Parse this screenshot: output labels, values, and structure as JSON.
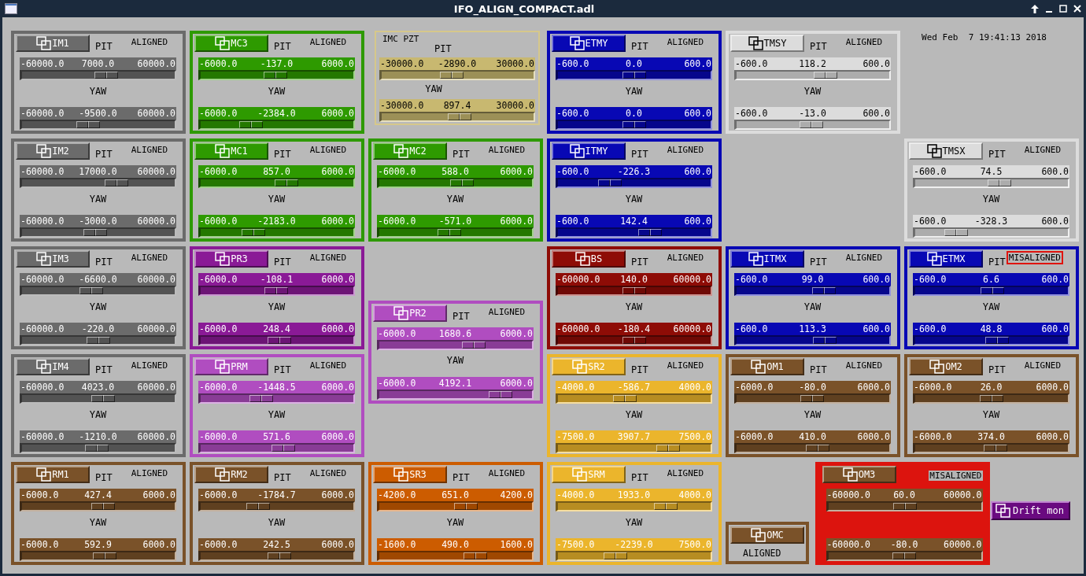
{
  "window": {
    "title": "IFO_ALIGN_COMPACT.adl"
  },
  "timestamp": "Wed Feb  7 19:41:13 2018",
  "cards": [
    {
      "kind": "suspension",
      "name": "IM1",
      "color": "#6b6b6b",
      "status": "ALIGNED",
      "misaligned": false,
      "sliders": [
        {
          "label": "PIT",
          "min": "-60000.0",
          "value": "7000.0",
          "max": "60000.0",
          "level": 0.558
        },
        {
          "label": "YAW",
          "min": "-60000.0",
          "value": "-9500.0",
          "max": "60000.0",
          "level": 0.421
        }
      ]
    },
    {
      "kind": "suspension",
      "name": "MC3",
      "color": "#2e9a00",
      "status": "ALIGNED",
      "misaligned": false,
      "sliders": [
        {
          "label": "PIT",
          "min": "-6000.0",
          "value": "-137.0",
          "max": "6000.0",
          "level": 0.489
        },
        {
          "label": "YAW",
          "min": "-6000.0",
          "value": "-2384.0",
          "max": "6000.0",
          "level": 0.301
        }
      ]
    },
    {
      "kind": "pzt",
      "name": "IMC PZT",
      "color": "#c8b870",
      "sliders": [
        {
          "label": "PIT",
          "min": "-30000.0",
          "value": "-2890.0",
          "max": "30000.0",
          "level": 0.452
        },
        {
          "label": "YAW",
          "min": "-30000.0",
          "value": "897.4",
          "max": "30000.0",
          "level": 0.515
        }
      ]
    },
    {
      "kind": "suspension",
      "name": "ETMY",
      "color": "#0808b4",
      "status": "ALIGNED",
      "misaligned": false,
      "sliders": [
        {
          "label": "PIT",
          "min": "-600.0",
          "value": "0.0",
          "max": "600.0",
          "level": 0.5
        },
        {
          "label": "YAW",
          "min": "-600.0",
          "value": "0.0",
          "max": "600.0",
          "level": 0.5
        }
      ]
    },
    {
      "kind": "suspension",
      "name": "TMSY",
      "color": "#dcdcdc",
      "status": "ALIGNED",
      "misaligned": false,
      "sliders": [
        {
          "label": "PIT",
          "min": "-600.0",
          "value": "118.2",
          "max": "600.0",
          "level": 0.599
        },
        {
          "label": "YAW",
          "min": "-600.0",
          "value": "-13.0",
          "max": "600.0",
          "level": 0.489
        }
      ]
    },
    {
      "kind": "suspension",
      "name": "IM2",
      "color": "#6b6b6b",
      "status": "ALIGNED",
      "misaligned": false,
      "sliders": [
        {
          "label": "PIT",
          "min": "-60000.0",
          "value": "17000.0",
          "max": "60000.0",
          "level": 0.642
        },
        {
          "label": "YAW",
          "min": "-60000.0",
          "value": "-3000.0",
          "max": "60000.0",
          "level": 0.475
        }
      ]
    },
    {
      "kind": "suspension",
      "name": "MC1",
      "color": "#2e9a00",
      "status": "ALIGNED",
      "misaligned": false,
      "sliders": [
        {
          "label": "PIT",
          "min": "-6000.0",
          "value": "857.0",
          "max": "6000.0",
          "level": 0.571
        },
        {
          "label": "YAW",
          "min": "-6000.0",
          "value": "-2183.0",
          "max": "6000.0",
          "level": 0.318
        }
      ]
    },
    {
      "kind": "suspension",
      "name": "MC2",
      "color": "#2e9a00",
      "status": "ALIGNED",
      "misaligned": false,
      "sliders": [
        {
          "label": "PIT",
          "min": "-6000.0",
          "value": "588.0",
          "max": "6000.0",
          "level": 0.549
        },
        {
          "label": "YAW",
          "min": "-6000.0",
          "value": "-571.0",
          "max": "6000.0",
          "level": 0.452
        }
      ]
    },
    {
      "kind": "suspension",
      "name": "ITMY",
      "color": "#0808b4",
      "status": "ALIGNED",
      "misaligned": false,
      "sliders": [
        {
          "label": "PIT",
          "min": "-600.0",
          "value": "-226.3",
          "max": "600.0",
          "level": 0.311
        },
        {
          "label": "YAW",
          "min": "-600.0",
          "value": "142.4",
          "max": "600.0",
          "level": 0.619
        }
      ]
    },
    {
      "kind": "suspension",
      "name": "TMSX",
      "color": "#dcdcdc",
      "status": "ALIGNED",
      "misaligned": false,
      "sliders": [
        {
          "label": "PIT",
          "min": "-600.0",
          "value": "74.5",
          "max": "600.0",
          "level": 0.562
        },
        {
          "label": "YAW",
          "min": "-600.0",
          "value": "-328.3",
          "max": "600.0",
          "level": 0.226
        }
      ]
    },
    {
      "kind": "suspension",
      "name": "IM3",
      "color": "#6b6b6b",
      "status": "ALIGNED",
      "misaligned": false,
      "sliders": [
        {
          "label": "PIT",
          "min": "-60000.0",
          "value": "-6600.0",
          "max": "60000.0",
          "level": 0.445
        },
        {
          "label": "YAW",
          "min": "-60000.0",
          "value": "-220.0",
          "max": "60000.0",
          "level": 0.498
        }
      ]
    },
    {
      "kind": "suspension",
      "name": "PR3",
      "color": "#8a1a96",
      "status": "ALIGNED",
      "misaligned": false,
      "sliders": [
        {
          "label": "PIT",
          "min": "-6000.0",
          "value": "-108.1",
          "max": "6000.0",
          "level": 0.491
        },
        {
          "label": "YAW",
          "min": "-6000.0",
          "value": "248.4",
          "max": "6000.0",
          "level": 0.521
        }
      ]
    },
    {
      "kind": "suspension",
      "name": "BS",
      "color": "#8e0c06",
      "status": "ALIGNED",
      "misaligned": false,
      "sliders": [
        {
          "label": "PIT",
          "min": "-60000.0",
          "value": "140.0",
          "max": "60000.0",
          "level": 0.501
        },
        {
          "label": "YAW",
          "min": "-60000.0",
          "value": "-180.4",
          "max": "60000.0",
          "level": 0.498
        }
      ]
    },
    {
      "kind": "suspension",
      "name": "ITMX",
      "color": "#0808b4",
      "status": "ALIGNED",
      "misaligned": false,
      "sliders": [
        {
          "label": "PIT",
          "min": "-600.0",
          "value": "99.0",
          "max": "600.0",
          "level": 0.583
        },
        {
          "label": "YAW",
          "min": "-600.0",
          "value": "113.3",
          "max": "600.0",
          "level": 0.594
        }
      ]
    },
    {
      "kind": "suspension",
      "name": "ETMX",
      "color": "#0808b4",
      "status": "MISALIGNED",
      "misaligned": true,
      "sliders": [
        {
          "label": "PIT",
          "min": "-600.0",
          "value": "6.6",
          "max": "600.0",
          "level": 0.506
        },
        {
          "label": "YAW",
          "min": "-600.0",
          "value": "48.8",
          "max": "600.0",
          "level": 0.541
        }
      ]
    },
    {
      "kind": "suspension",
      "name": "PR2",
      "color": "#b04dc0",
      "status": "ALIGNED",
      "misaligned": false,
      "sliders": [
        {
          "label": "PIT",
          "min": "-6000.0",
          "value": "1680.6",
          "max": "6000.0",
          "level": 0.64
        },
        {
          "label": "YAW",
          "min": "-6000.0",
          "value": "4192.1",
          "max": "6000.0",
          "level": 0.849
        }
      ]
    },
    {
      "kind": "suspension",
      "name": "IM4",
      "color": "#6b6b6b",
      "status": "ALIGNED",
      "misaligned": false,
      "sliders": [
        {
          "label": "PIT",
          "min": "-60000.0",
          "value": "4023.0",
          "max": "60000.0",
          "level": 0.534
        },
        {
          "label": "YAW",
          "min": "-60000.0",
          "value": "-1210.0",
          "max": "60000.0",
          "level": 0.49
        }
      ]
    },
    {
      "kind": "suspension",
      "name": "PRM",
      "color": "#b04dc0",
      "status": "ALIGNED",
      "misaligned": false,
      "sliders": [
        {
          "label": "PIT",
          "min": "-6000.0",
          "value": "-1448.5",
          "max": "6000.0",
          "level": 0.379
        },
        {
          "label": "YAW",
          "min": "-6000.0",
          "value": "571.6",
          "max": "6000.0",
          "level": 0.548
        }
      ]
    },
    {
      "kind": "suspension",
      "name": "SR2",
      "color": "#ebb52c",
      "status": "ALIGNED",
      "misaligned": false,
      "sliders": [
        {
          "label": "PIT",
          "min": "-4000.0",
          "value": "-586.7",
          "max": "4000.0",
          "level": 0.427
        },
        {
          "label": "YAW",
          "min": "-7500.0",
          "value": "3907.7",
          "max": "7500.0",
          "level": 0.761
        }
      ]
    },
    {
      "kind": "suspension",
      "name": "OM1",
      "color": "#7a5229",
      "status": "ALIGNED",
      "misaligned": false,
      "sliders": [
        {
          "label": "PIT",
          "min": "-6000.0",
          "value": "-80.0",
          "max": "6000.0",
          "level": 0.493
        },
        {
          "label": "YAW",
          "min": "-6000.0",
          "value": "410.0",
          "max": "6000.0",
          "level": 0.534
        }
      ]
    },
    {
      "kind": "suspension",
      "name": "OM2",
      "color": "#7a5229",
      "status": "ALIGNED",
      "misaligned": false,
      "sliders": [
        {
          "label": "PIT",
          "min": "-6000.0",
          "value": "26.0",
          "max": "6000.0",
          "level": 0.502
        },
        {
          "label": "YAW",
          "min": "-6000.0",
          "value": "374.0",
          "max": "6000.0",
          "level": 0.531
        }
      ]
    },
    {
      "kind": "suspension",
      "name": "RM1",
      "color": "#7a5229",
      "status": "ALIGNED",
      "misaligned": false,
      "sliders": [
        {
          "label": "PIT",
          "min": "-6000.0",
          "value": "427.4",
          "max": "6000.0",
          "level": 0.536
        },
        {
          "label": "YAW",
          "min": "-6000.0",
          "value": "592.9",
          "max": "6000.0",
          "level": 0.549
        }
      ]
    },
    {
      "kind": "suspension",
      "name": "RM2",
      "color": "#7a5229",
      "status": "ALIGNED",
      "misaligned": false,
      "sliders": [
        {
          "label": "PIT",
          "min": "-6000.0",
          "value": "-1784.7",
          "max": "6000.0",
          "level": 0.351
        },
        {
          "label": "YAW",
          "min": "-6000.0",
          "value": "242.5",
          "max": "6000.0",
          "level": 0.52
        }
      ]
    },
    {
      "kind": "suspension",
      "name": "SR3",
      "color": "#cc5c00",
      "status": "ALIGNED",
      "misaligned": false,
      "sliders": [
        {
          "label": "PIT",
          "min": "-4200.0",
          "value": "651.0",
          "max": "4200.0",
          "level": 0.578
        },
        {
          "label": "YAW",
          "min": "-1600.0",
          "value": "490.0",
          "max": "1600.0",
          "level": 0.653
        }
      ]
    },
    {
      "kind": "suspension",
      "name": "SRM",
      "color": "#ebb52c",
      "status": "ALIGNED",
      "misaligned": false,
      "sliders": [
        {
          "label": "PIT",
          "min": "-4000.0",
          "value": "1933.0",
          "max": "4000.0",
          "level": 0.742
        },
        {
          "label": "YAW",
          "min": "-7500.0",
          "value": "-2239.0",
          "max": "7500.0",
          "level": 0.351
        }
      ]
    },
    {
      "kind": "omc",
      "name": "OMC",
      "color": "#7a5229",
      "status": "ALIGNED"
    },
    {
      "kind": "alarm",
      "name": "OM3",
      "color": "#7a5229",
      "status": "MISALIGNED",
      "misaligned": true,
      "sliders": [
        {
          "min": "-60000.0",
          "value": "60.0",
          "max": "60000.0",
          "level": 0.5
        },
        {
          "min": "-60000.0",
          "value": "-80.0",
          "max": "60000.0",
          "level": 0.499
        }
      ]
    }
  ],
  "drift_button": {
    "label": "Drift mon"
  }
}
